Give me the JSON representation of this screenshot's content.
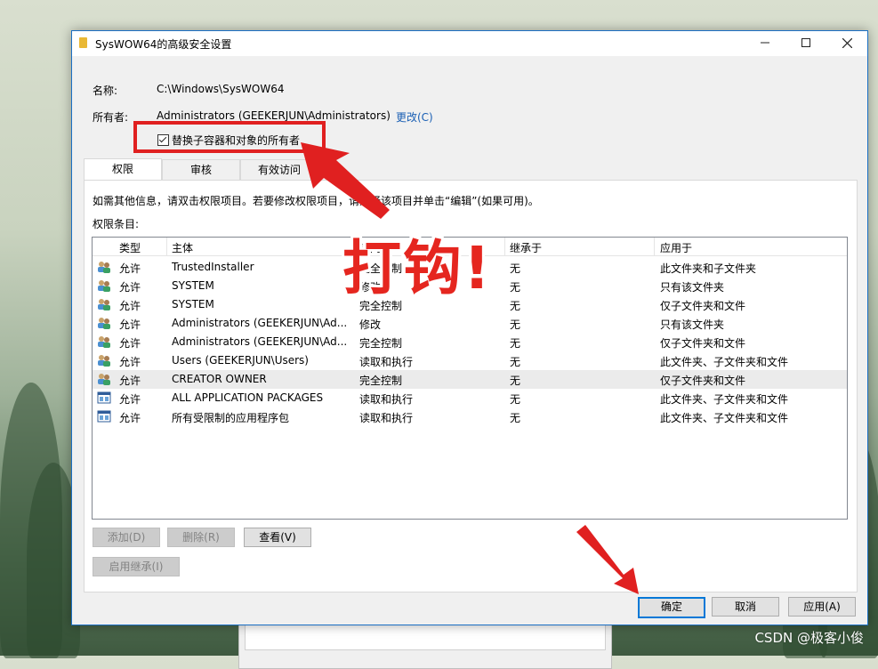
{
  "dialog": {
    "title": "SysWOW64的高级安全设置",
    "name_label": "名称:",
    "name_value": "C:\\Windows\\SysWOW64",
    "owner_label": "所有者:",
    "owner_value": "Administrators (GEEKERJUN\\Administrators)",
    "change_link": "更改(C)",
    "replace_owner_checkbox": "替换子容器和对象的所有者",
    "replace_owner_checked": true
  },
  "tabs": [
    {
      "label": "权限",
      "active": true
    },
    {
      "label": "审核",
      "active": false
    },
    {
      "label": "有效访问",
      "active": false
    }
  ],
  "panel": {
    "info_text": "如需其他信息，请双击权限项目。若要修改权限项目，请选择该项目并单击“编辑”(如果可用)。",
    "entries_label": "权限条目:"
  },
  "table": {
    "headers": [
      "类型",
      "主体",
      "访问",
      "继承于",
      "应用于"
    ],
    "rows": [
      {
        "icon": "users-icon",
        "type": "允许",
        "principal": "TrustedInstaller",
        "access": "完全控制",
        "inherit": "无",
        "apply": "此文件夹和子文件夹"
      },
      {
        "icon": "users-icon",
        "type": "允许",
        "principal": "SYSTEM",
        "access": "修改",
        "inherit": "无",
        "apply": "只有该文件夹"
      },
      {
        "icon": "users-icon",
        "type": "允许",
        "principal": "SYSTEM",
        "access": "完全控制",
        "inherit": "无",
        "apply": "仅子文件夹和文件"
      },
      {
        "icon": "users-icon",
        "type": "允许",
        "principal": "Administrators (GEEKERJUN\\Ad...",
        "access": "修改",
        "inherit": "无",
        "apply": "只有该文件夹"
      },
      {
        "icon": "users-icon",
        "type": "允许",
        "principal": "Administrators (GEEKERJUN\\Ad...",
        "access": "完全控制",
        "inherit": "无",
        "apply": "仅子文件夹和文件"
      },
      {
        "icon": "users-icon",
        "type": "允许",
        "principal": "Users (GEEKERJUN\\Users)",
        "access": "读取和执行",
        "inherit": "无",
        "apply": "此文件夹、子文件夹和文件"
      },
      {
        "icon": "users-icon",
        "type": "允许",
        "principal": "CREATOR OWNER",
        "access": "完全控制",
        "inherit": "无",
        "apply": "仅子文件夹和文件",
        "selected": true
      },
      {
        "icon": "app-package-icon",
        "type": "允许",
        "principal": "ALL APPLICATION PACKAGES",
        "access": "读取和执行",
        "inherit": "无",
        "apply": "此文件夹、子文件夹和文件"
      },
      {
        "icon": "app-package-icon",
        "type": "允许",
        "principal": "所有受限制的应用程序包",
        "access": "读取和执行",
        "inherit": "无",
        "apply": "此文件夹、子文件夹和文件"
      }
    ]
  },
  "buttons": {
    "add": "添加(D)",
    "remove": "删除(R)",
    "view": "查看(V)",
    "enable_inheritance": "启用继承(I)",
    "ok": "确定",
    "cancel": "取消",
    "apply": "应用(A)"
  },
  "annotation": {
    "text": "打钩!",
    "color": "#e02020"
  },
  "watermark": "CSDN @极客小俊"
}
